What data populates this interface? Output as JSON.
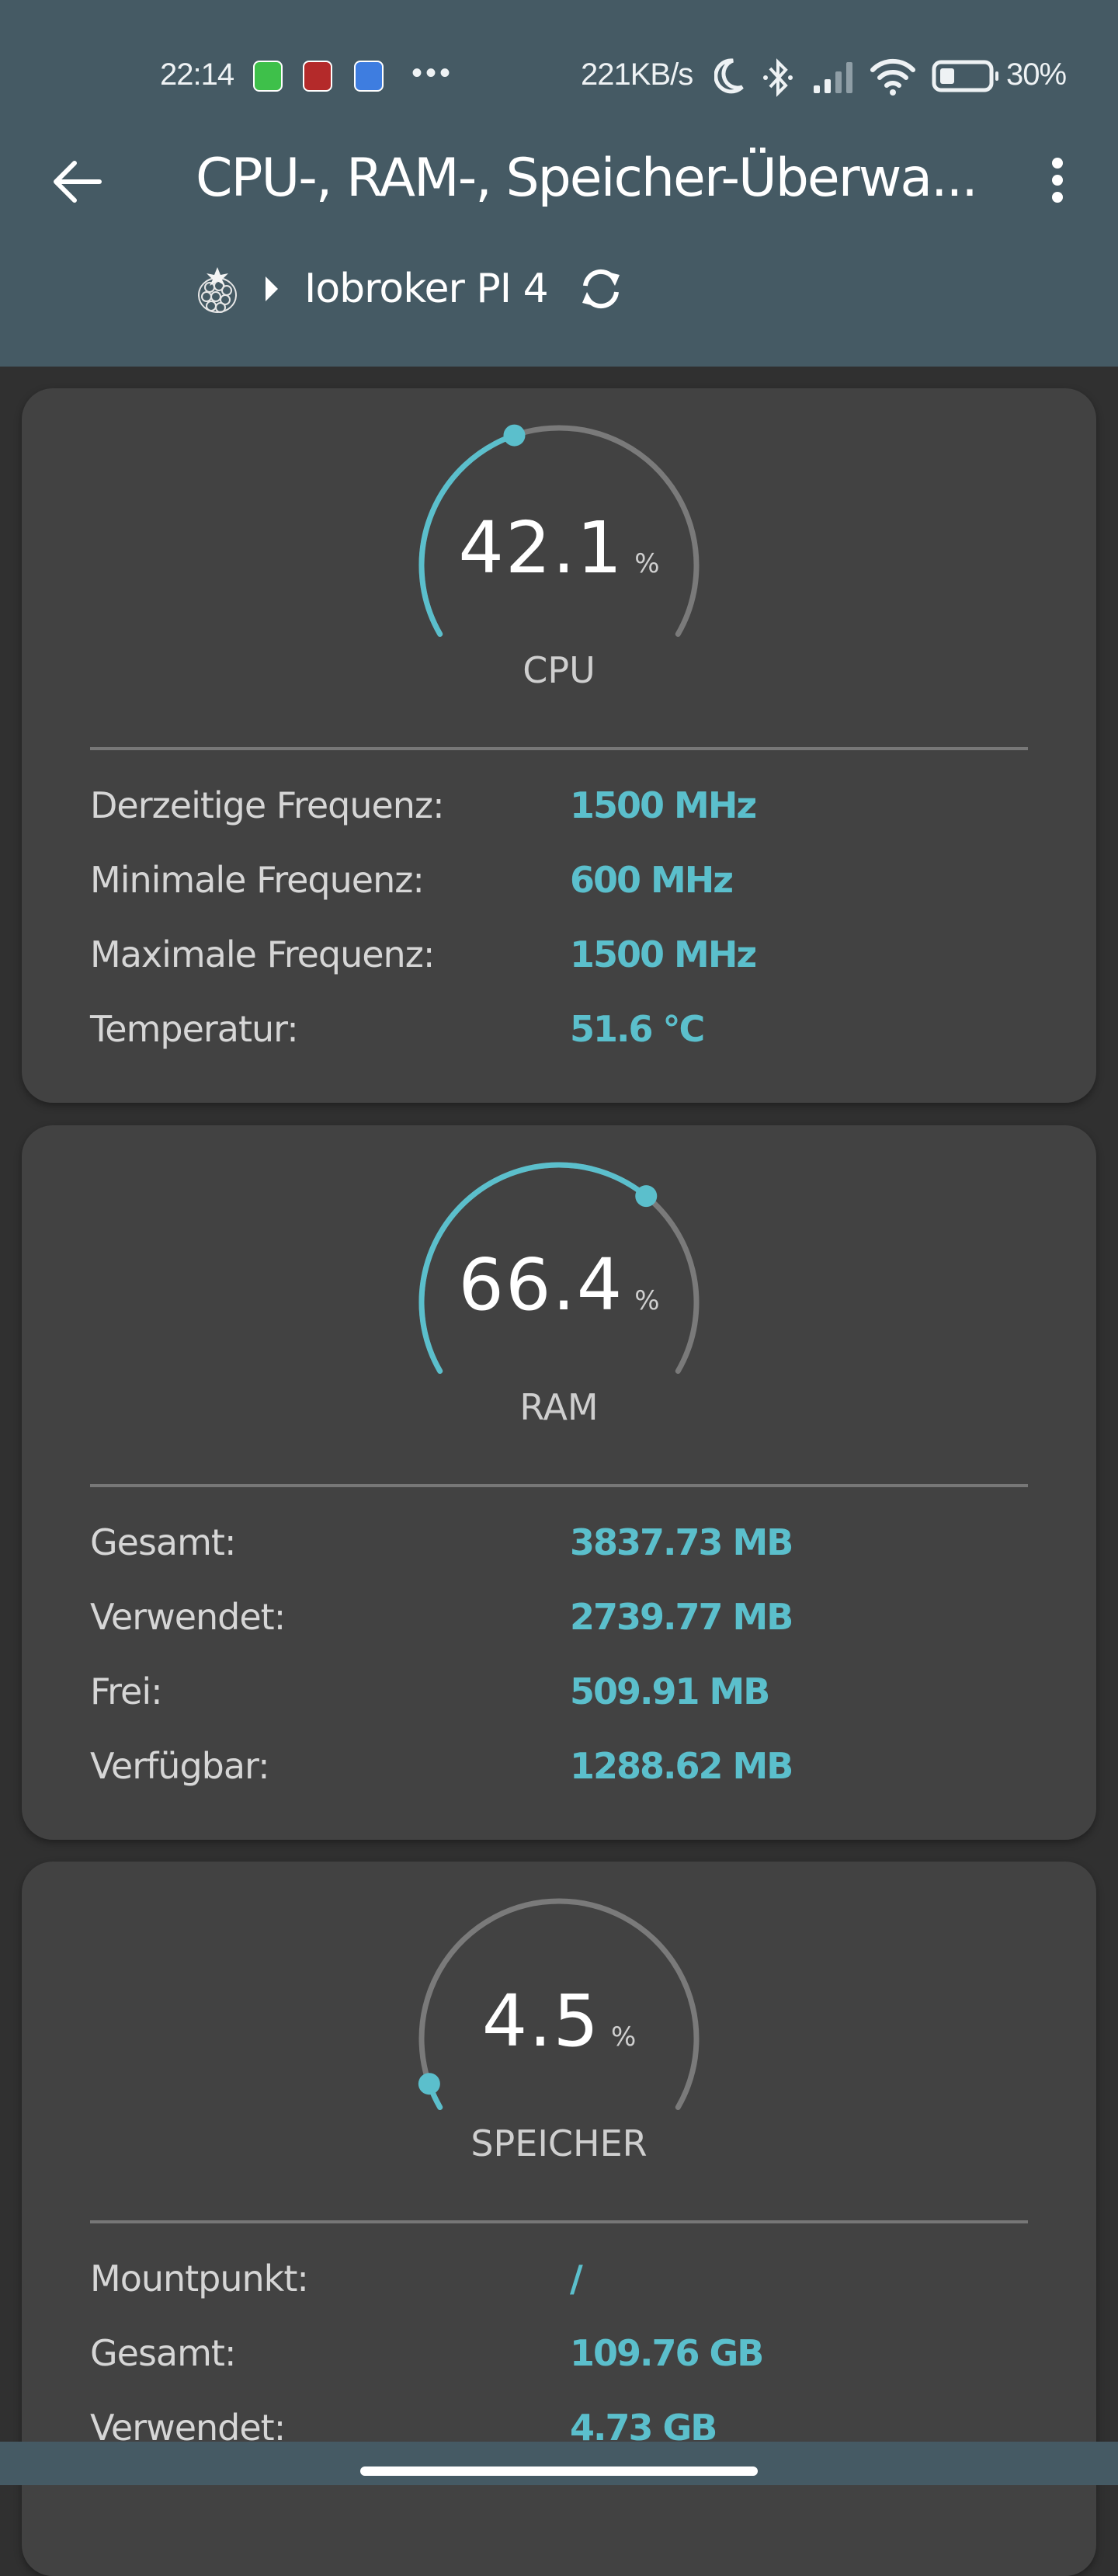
{
  "status_bar": {
    "time": "22:14",
    "notification_icons": [
      "whatsapp-icon",
      "red-app-icon",
      "home-assistant-icon"
    ],
    "more": "•••",
    "net_speed": "221KB/s",
    "system_icons": [
      "moon-icon",
      "bluetooth-icon",
      "signal-icon",
      "wifi-icon",
      "battery-icon"
    ],
    "battery_percent": "30%"
  },
  "app_bar": {
    "title": "CPU-, RAM-, Speicher-Überwa...",
    "breadcrumb": {
      "icon": "raspberry-icon",
      "label": "Iobroker PI 4"
    }
  },
  "theme": {
    "header_bg": "#455a64",
    "page_bg": "#303030",
    "card_bg": "#424242",
    "accent": "#5bbfcc",
    "track": "#7a7a7a"
  },
  "cards": [
    {
      "gauge": {
        "value": "42.1",
        "unit": "%",
        "label": "CPU",
        "percent": 42.1
      },
      "rows": [
        {
          "label": "Derzeitige Frequenz:",
          "value": "1500 MHz"
        },
        {
          "label": "Minimale Frequenz:",
          "value": "600 MHz"
        },
        {
          "label": "Maximale Frequenz:",
          "value": "1500 MHz"
        },
        {
          "label": "Temperatur:",
          "value": "51.6 °C"
        }
      ]
    },
    {
      "gauge": {
        "value": "66.4",
        "unit": "%",
        "label": "RAM",
        "percent": 66.4
      },
      "rows": [
        {
          "label": "Gesamt:",
          "value": "3837.73 MB"
        },
        {
          "label": "Verwendet:",
          "value": "2739.77 MB"
        },
        {
          "label": "Frei:",
          "value": "509.91 MB"
        },
        {
          "label": "Verfügbar:",
          "value": "1288.62 MB"
        }
      ]
    },
    {
      "gauge": {
        "value": "4.5",
        "unit": "%",
        "label": "SPEICHER",
        "percent": 4.5
      },
      "rows": [
        {
          "label": "Mountpunkt:",
          "value": "/"
        },
        {
          "label": "Gesamt:",
          "value": "109.76 GB"
        },
        {
          "label": "Verwendet:",
          "value": "4.73 GB"
        }
      ]
    }
  ]
}
